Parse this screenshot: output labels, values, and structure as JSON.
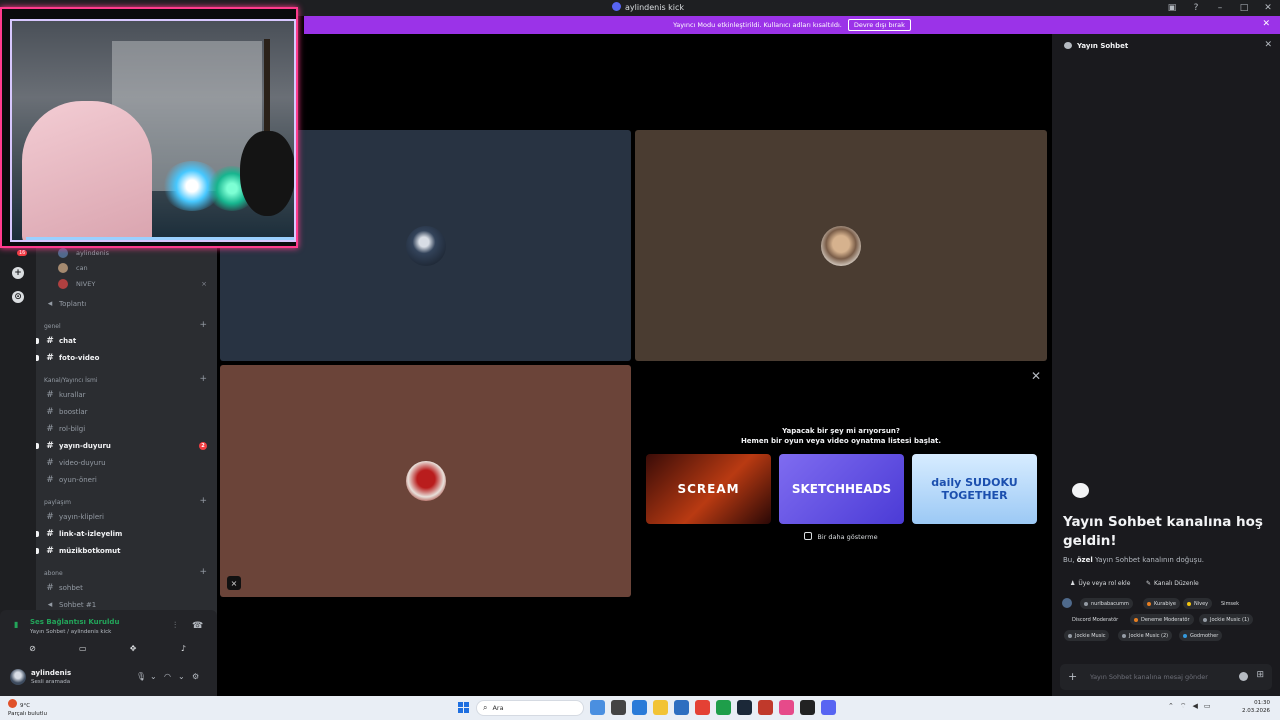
{
  "window": {
    "title": "aylindenis kick"
  },
  "banner": {
    "text": "Yayıncı Modu etkinleştirildi. Kullanıcı adları kısaltıldı.",
    "button": "Devre dışı bırak"
  },
  "servers": {
    "badge": "16"
  },
  "channels": {
    "voice_users": [
      "aylindenis",
      "can",
      "NIVEY"
    ],
    "meeting": "Toplantı",
    "categories": {
      "genel": "genel",
      "kanal": "Kanal/Yayıncı İsmi",
      "paylasim": "paylaşım",
      "abone": "abone"
    },
    "items": {
      "chat": "chat",
      "foto_video": "foto-video",
      "kurallar": "kurallar",
      "boostlar": "boostlar",
      "rol_bilgi": "rol-bilgi",
      "yayin_duyuru": "yayın-duyuru",
      "yayin_duyuru_badge": "2",
      "video_duyuru": "video-duyuru",
      "oyun_oneri": "oyun-öneri",
      "yayin_klipleri": "yayın-klipleri",
      "link_at": "link-at-izleyelim",
      "muzikbot": "müzikbotkomut",
      "sohbet": "sohbet",
      "sohbet1": "Sohbet #1"
    }
  },
  "voice": {
    "status": "Ses Bağlantısı Kuruldu",
    "location": "Yayın Sohbet / aylindenis kick"
  },
  "user": {
    "name": "aylindenis",
    "status": "Sesli aramada"
  },
  "activity": {
    "question": "Yapacak bir şey mi arıyorsun?",
    "subtitle": "Hemen bir oyun veya video oynatma listesi başlat.",
    "games": [
      "SCREAM",
      "SKETCHHEADS",
      "daily SUDOKU TOGETHER"
    ],
    "dont_show": "Bir daha gösterme"
  },
  "chat_panel": {
    "title": "Yayın Sohbet",
    "welcome": "Yayın Sohbet kanalına hoş geldin!",
    "sub_prefix": "Bu, ",
    "sub_bold": "özel",
    "sub_suffix": " Yayın Sohbet kanalının doğuşu.",
    "add_member": "Üye veya rol ekle",
    "edit_channel": "Kanalı Düzenle",
    "roles": [
      "nurlbabacumm",
      "Kurabiye",
      "Nivey",
      "Simsek",
      "Discord Moderatör",
      "Deneme Moderatör",
      "Jockie Music (1)",
      "Jockie Music",
      "Jockie Music (2)",
      "Godmother"
    ],
    "role_colors": [
      "#949ba4",
      "#e67e22",
      "#f1c40f",
      "#ffffff",
      "#ffffff",
      "#e67e22",
      "#949ba4",
      "#949ba4",
      "#949ba4",
      "#3498db"
    ],
    "input_placeholder": "Yayın Sohbet kanalına mesaj gönder"
  },
  "taskbar": {
    "temp": "9°C",
    "weather": "Parçalı bulutlu",
    "search": "Ara",
    "time": "01:30",
    "date": "2.03.2026"
  }
}
